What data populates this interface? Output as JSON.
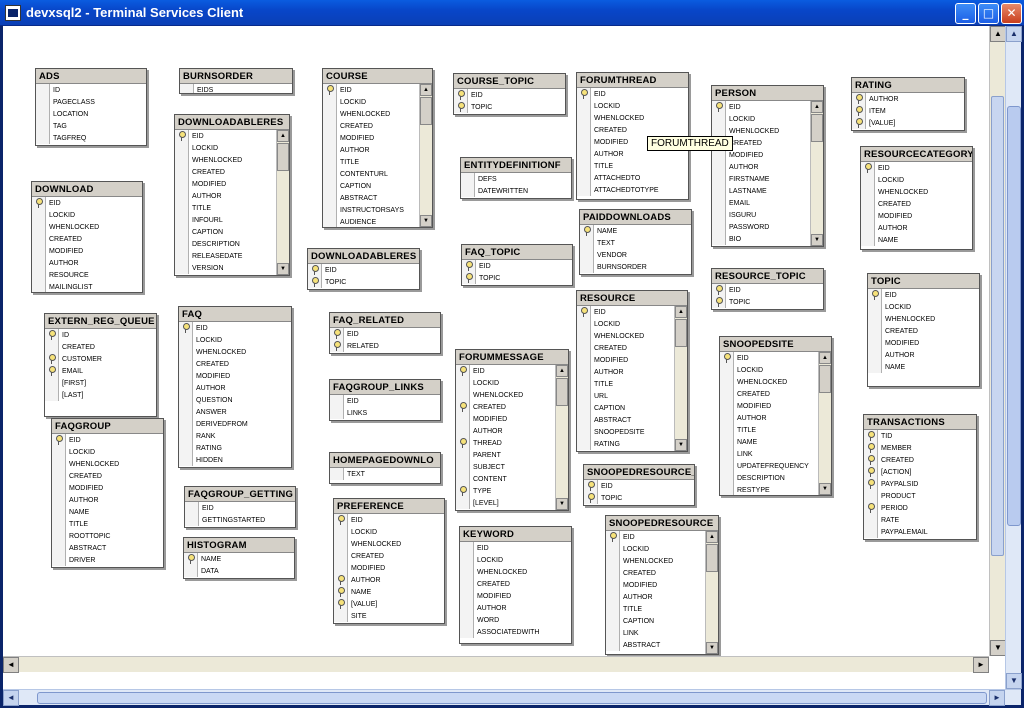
{
  "window": {
    "title": "devxsql2 - Terminal Services Client",
    "minimize": "_",
    "maximize": "□",
    "close": "✕"
  },
  "tooltip": "FORUMTHREAD",
  "icons": {
    "key": "key-icon",
    "up": "▲",
    "down": "▼",
    "left": "◄",
    "right": "►"
  },
  "tables": [
    {
      "name": "ADS",
      "fields": [
        {
          "n": "ID"
        },
        {
          "n": "PAGECLASS"
        },
        {
          "n": "LOCATION"
        },
        {
          "n": "TAG"
        },
        {
          "n": "TAGFREQ"
        }
      ]
    },
    {
      "name": "BURNSORDER",
      "fields": [
        {
          "n": "EIDS"
        }
      ]
    },
    {
      "name": "COURSE",
      "fields": [
        {
          "n": "EID",
          "k": 1
        },
        {
          "n": "LOCKID"
        },
        {
          "n": "WHENLOCKED"
        },
        {
          "n": "CREATED"
        },
        {
          "n": "MODIFIED"
        },
        {
          "n": "AUTHOR"
        },
        {
          "n": "TITLE"
        },
        {
          "n": "CONTENTURL"
        },
        {
          "n": "CAPTION"
        },
        {
          "n": "ABSTRACT"
        },
        {
          "n": "INSTRUCTORSAYS"
        },
        {
          "n": "AUDIENCE"
        }
      ],
      "scroll": true
    },
    {
      "name": "COURSE_TOPIC",
      "fields": [
        {
          "n": "EID",
          "k": 1
        },
        {
          "n": "TOPIC",
          "k": 1
        }
      ]
    },
    {
      "name": "FORUMTHREAD",
      "fields": [
        {
          "n": "EID",
          "k": 1
        },
        {
          "n": "LOCKID"
        },
        {
          "n": "WHENLOCKED"
        },
        {
          "n": "CREATED"
        },
        {
          "n": "MODIFIED"
        },
        {
          "n": "AUTHOR"
        },
        {
          "n": "TITLE"
        },
        {
          "n": "ATTACHEDTO"
        },
        {
          "n": "ATTACHEDTOTYPE"
        }
      ]
    },
    {
      "name": "PERSON",
      "fields": [
        {
          "n": "EID",
          "k": 1
        },
        {
          "n": "LOCKID"
        },
        {
          "n": "WHENLOCKED"
        },
        {
          "n": "CREATED"
        },
        {
          "n": "MODIFIED"
        },
        {
          "n": "AUTHOR"
        },
        {
          "n": "FIRSTNAME"
        },
        {
          "n": "LASTNAME"
        },
        {
          "n": "EMAIL"
        },
        {
          "n": "ISGURU"
        },
        {
          "n": "PASSWORD"
        },
        {
          "n": "BIO"
        }
      ],
      "scroll": true
    },
    {
      "name": "RATING",
      "fields": [
        {
          "n": "AUTHOR",
          "k": 1
        },
        {
          "n": "ITEM",
          "k": 1
        },
        {
          "n": "[VALUE]",
          "k": 1
        }
      ]
    },
    {
      "name": "DOWNLOADABLERES",
      "fields": [
        {
          "n": "EID",
          "k": 1
        },
        {
          "n": "LOCKID"
        },
        {
          "n": "WHENLOCKED"
        },
        {
          "n": "CREATED"
        },
        {
          "n": "MODIFIED"
        },
        {
          "n": "AUTHOR"
        },
        {
          "n": "TITLE"
        },
        {
          "n": "INFOURL"
        },
        {
          "n": "CAPTION"
        },
        {
          "n": "DESCRIPTION"
        },
        {
          "n": "RELEASEDATE"
        },
        {
          "n": "VERSION"
        }
      ],
      "scroll": true
    },
    {
      "name": "ENTITYDEFINITIONF",
      "fields": [
        {
          "n": "DEFS"
        },
        {
          "n": "DATEWRITTEN"
        }
      ]
    },
    {
      "name": "RESOURCECATEGORY",
      "fields": [
        {
          "n": "EID",
          "k": 1
        },
        {
          "n": "LOCKID"
        },
        {
          "n": "WHENLOCKED"
        },
        {
          "n": "CREATED"
        },
        {
          "n": "MODIFIED"
        },
        {
          "n": "AUTHOR"
        },
        {
          "n": "NAME"
        }
      ]
    },
    {
      "name": "DOWNLOAD",
      "fields": [
        {
          "n": "EID",
          "k": 1
        },
        {
          "n": "LOCKID"
        },
        {
          "n": "WHENLOCKED"
        },
        {
          "n": "CREATED"
        },
        {
          "n": "MODIFIED"
        },
        {
          "n": "AUTHOR"
        },
        {
          "n": "RESOURCE"
        },
        {
          "n": "MAILINGLIST"
        }
      ]
    },
    {
      "name": "PAIDDOWNLOADS",
      "fields": [
        {
          "n": "NAME",
          "k": 1
        },
        {
          "n": "TEXT"
        },
        {
          "n": "VENDOR"
        },
        {
          "n": "BURNSORDER"
        }
      ]
    },
    {
      "name": "DOWNLOADABLERES",
      "fields": [
        {
          "n": "EID",
          "k": 1
        },
        {
          "n": "TOPIC",
          "k": 1
        }
      ]
    },
    {
      "name": "FAQ_TOPIC",
      "fields": [
        {
          "n": "EID",
          "k": 1
        },
        {
          "n": "TOPIC",
          "k": 1
        }
      ]
    },
    {
      "name": "RESOURCE_TOPIC",
      "fields": [
        {
          "n": "EID",
          "k": 1
        },
        {
          "n": "TOPIC",
          "k": 1
        }
      ]
    },
    {
      "name": "TOPIC",
      "fields": [
        {
          "n": "EID",
          "k": 1
        },
        {
          "n": "LOCKID"
        },
        {
          "n": "WHENLOCKED"
        },
        {
          "n": "CREATED"
        },
        {
          "n": "MODIFIED"
        },
        {
          "n": "AUTHOR"
        },
        {
          "n": "NAME"
        }
      ]
    },
    {
      "name": "RESOURCE",
      "fields": [
        {
          "n": "EID",
          "k": 1
        },
        {
          "n": "LOCKID"
        },
        {
          "n": "WHENLOCKED"
        },
        {
          "n": "CREATED"
        },
        {
          "n": "MODIFIED"
        },
        {
          "n": "AUTHOR"
        },
        {
          "n": "TITLE"
        },
        {
          "n": "URL"
        },
        {
          "n": "CAPTION"
        },
        {
          "n": "ABSTRACT"
        },
        {
          "n": "SNOOPEDSITE"
        },
        {
          "n": "RATING"
        }
      ],
      "scroll": true
    },
    {
      "name": "EXTERN_REG_QUEUE",
      "fields": [
        {
          "n": "ID",
          "k": 1
        },
        {
          "n": "CREATED"
        },
        {
          "n": "CUSTOMER",
          "k": 1
        },
        {
          "n": "EMAIL",
          "k": 1
        },
        {
          "n": "[FIRST]"
        },
        {
          "n": "[LAST]"
        }
      ]
    },
    {
      "name": "FAQ",
      "fields": [
        {
          "n": "EID",
          "k": 1
        },
        {
          "n": "LOCKID"
        },
        {
          "n": "WHENLOCKED"
        },
        {
          "n": "CREATED"
        },
        {
          "n": "MODIFIED"
        },
        {
          "n": "AUTHOR"
        },
        {
          "n": "QUESTION"
        },
        {
          "n": "ANSWER"
        },
        {
          "n": "DERIVEDFROM"
        },
        {
          "n": "RANK"
        },
        {
          "n": "RATING"
        },
        {
          "n": "HIDDEN"
        }
      ]
    },
    {
      "name": "FAQ_RELATED",
      "fields": [
        {
          "n": "EID",
          "k": 1
        },
        {
          "n": "RELATED",
          "k": 1
        }
      ]
    },
    {
      "name": "SNOOPEDSITE",
      "fields": [
        {
          "n": "EID",
          "k": 1
        },
        {
          "n": "LOCKID"
        },
        {
          "n": "WHENLOCKED"
        },
        {
          "n": "CREATED"
        },
        {
          "n": "MODIFIED"
        },
        {
          "n": "AUTHOR"
        },
        {
          "n": "TITLE"
        },
        {
          "n": "NAME"
        },
        {
          "n": "LINK"
        },
        {
          "n": "UPDATEFREQUENCY"
        },
        {
          "n": "DESCRIPTION"
        },
        {
          "n": "RESTYPE"
        }
      ],
      "scroll": true
    },
    {
      "name": "FORUMMESSAGE",
      "fields": [
        {
          "n": "EID",
          "k": 1
        },
        {
          "n": "LOCKID"
        },
        {
          "n": "WHENLOCKED"
        },
        {
          "n": "CREATED",
          "k": 1
        },
        {
          "n": "MODIFIED"
        },
        {
          "n": "AUTHOR"
        },
        {
          "n": "THREAD",
          "k": 1
        },
        {
          "n": "PARENT"
        },
        {
          "n": "SUBJECT"
        },
        {
          "n": "CONTENT"
        },
        {
          "n": "TYPE",
          "k": 1
        },
        {
          "n": "[LEVEL]"
        }
      ],
      "scroll": true
    },
    {
      "name": "FAQGROUP_LINKS",
      "fields": [
        {
          "n": "EID"
        },
        {
          "n": "LINKS"
        }
      ]
    },
    {
      "name": "TRANSACTIONS",
      "fields": [
        {
          "n": "TID",
          "k": 1
        },
        {
          "n": "MEMBER",
          "k": 1
        },
        {
          "n": "CREATED",
          "k": 1
        },
        {
          "n": "[ACTION]",
          "k": 1
        },
        {
          "n": "PAYPALSID",
          "k": 1
        },
        {
          "n": "PRODUCT"
        },
        {
          "n": "PERIOD",
          "k": 1
        },
        {
          "n": "RATE"
        },
        {
          "n": "PAYPALEMAIL"
        }
      ]
    },
    {
      "name": "FAQGROUP",
      "fields": [
        {
          "n": "EID",
          "k": 1
        },
        {
          "n": "LOCKID"
        },
        {
          "n": "WHENLOCKED"
        },
        {
          "n": "CREATED"
        },
        {
          "n": "MODIFIED"
        },
        {
          "n": "AUTHOR"
        },
        {
          "n": "NAME"
        },
        {
          "n": "TITLE"
        },
        {
          "n": "ROOTTOPIC"
        },
        {
          "n": "ABSTRACT"
        },
        {
          "n": "DRIVER"
        }
      ]
    },
    {
      "name": "HOMEPAGEDOWNLO",
      "fields": [
        {
          "n": "TEXT"
        }
      ]
    },
    {
      "name": "SNOOPEDRESOURCE_",
      "fields": [
        {
          "n": "EID",
          "k": 1
        },
        {
          "n": "TOPIC",
          "k": 1
        }
      ]
    },
    {
      "name": "FAQGROUP_GETTING",
      "fields": [
        {
          "n": "EID"
        },
        {
          "n": "GETTINGSTARTED"
        }
      ]
    },
    {
      "name": "PREFERENCE",
      "fields": [
        {
          "n": "EID",
          "k": 1
        },
        {
          "n": "LOCKID"
        },
        {
          "n": "WHENLOCKED"
        },
        {
          "n": "CREATED"
        },
        {
          "n": "MODIFIED"
        },
        {
          "n": "AUTHOR",
          "k": 1
        },
        {
          "n": "NAME",
          "k": 1
        },
        {
          "n": "[VALUE]",
          "k": 1
        },
        {
          "n": "SITE"
        }
      ]
    },
    {
      "name": "KEYWORD",
      "fields": [
        {
          "n": "EID"
        },
        {
          "n": "LOCKID"
        },
        {
          "n": "WHENLOCKED"
        },
        {
          "n": "CREATED"
        },
        {
          "n": "MODIFIED"
        },
        {
          "n": "AUTHOR"
        },
        {
          "n": "WORD"
        },
        {
          "n": "ASSOCIATEDWITH"
        }
      ]
    },
    {
      "name": "SNOOPEDRESOURCE",
      "fields": [
        {
          "n": "EID",
          "k": 1
        },
        {
          "n": "LOCKID"
        },
        {
          "n": "WHENLOCKED"
        },
        {
          "n": "CREATED"
        },
        {
          "n": "MODIFIED"
        },
        {
          "n": "AUTHOR"
        },
        {
          "n": "TITLE"
        },
        {
          "n": "CAPTION"
        },
        {
          "n": "LINK"
        },
        {
          "n": "ABSTRACT"
        }
      ],
      "scroll": true
    },
    {
      "name": "HISTOGRAM",
      "fields": [
        {
          "n": "NAME",
          "k": 1
        },
        {
          "n": "DATA"
        }
      ]
    }
  ]
}
